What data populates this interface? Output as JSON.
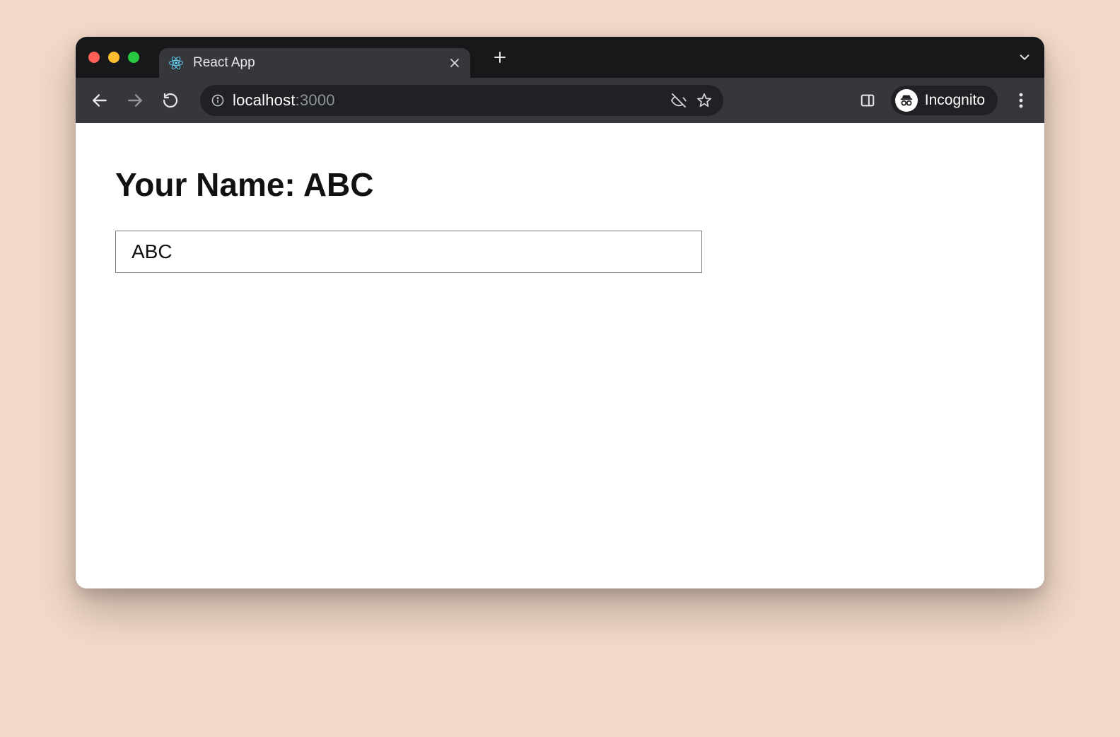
{
  "browser": {
    "tab": {
      "title": "React App"
    },
    "omnibox": {
      "host": "localhost",
      "port": ":3000"
    },
    "incognito_label": "Incognito"
  },
  "page": {
    "heading_prefix": "Your Name: ",
    "name_value": "ABC"
  }
}
